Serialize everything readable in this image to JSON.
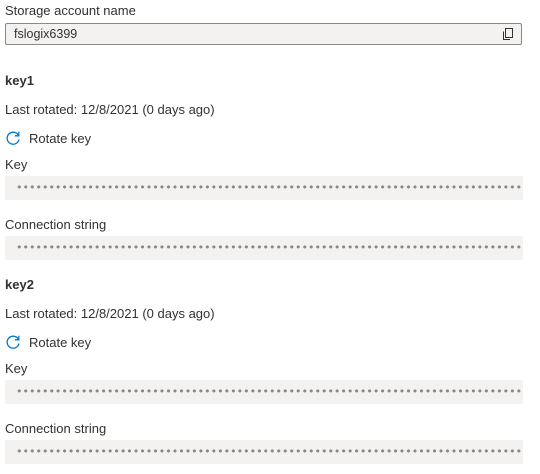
{
  "storage": {
    "label": "Storage account name",
    "value": "fslogix6399",
    "copy_icon": "copy-icon"
  },
  "keys": [
    {
      "title": "key1",
      "last_rotated": "Last rotated: 12/8/2021 (0 days ago)",
      "rotate_label": "Rotate key",
      "key_label": "Key",
      "key_value": "••••••••••••••••••••••••••••••••••••••••••••••••••••••••••••••••••••••••••••••••••••••",
      "conn_label": "Connection string",
      "conn_value": "•••••••••••••••••••••••••••••••••••••••••••••••••••••••••••••••••••••••••••••••••••••••••••..."
    },
    {
      "title": "key2",
      "last_rotated": "Last rotated: 12/8/2021 (0 days ago)",
      "rotate_label": "Rotate key",
      "key_label": "Key",
      "key_value": "••••••••••••••••••••••••••••••••••••••••••••••••••••••••••••••••••••••••••••••••••••••",
      "conn_label": "Connection string",
      "conn_value": "•••••••••••••••••••••••••••••••••••••••••••••••••••••••••••••••••••••••••••••••••••••••••••..."
    }
  ],
  "colors": {
    "accent": "#0078d4",
    "field_bg": "#f3f2f1",
    "text": "#323130"
  }
}
